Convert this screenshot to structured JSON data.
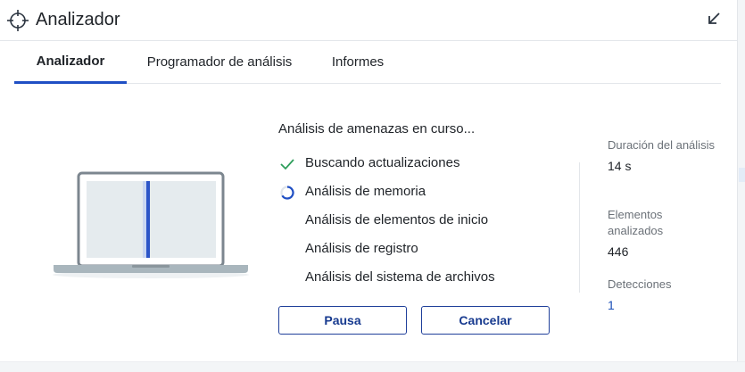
{
  "app": {
    "title": "Analizador",
    "icon": "crosshair-icon",
    "collapse_icon": "arrow-down-left-icon"
  },
  "tabs": [
    {
      "label": "Analizador",
      "active": true
    },
    {
      "label": "Programador de análisis",
      "active": false
    },
    {
      "label": "Informes",
      "active": false
    }
  ],
  "scan": {
    "status_title": "Análisis de amenazas en curso...",
    "steps": [
      {
        "label": "Buscando actualizaciones",
        "state": "done",
        "icon": "check-icon"
      },
      {
        "label": "Análisis de memoria",
        "state": "in-progress",
        "icon": "spinner-icon"
      },
      {
        "label": "Análisis de elementos de inicio",
        "state": "pending"
      },
      {
        "label": "Análisis de registro",
        "state": "pending"
      },
      {
        "label": "Análisis del sistema de archivos",
        "state": "pending"
      }
    ],
    "progress_fraction": 0.5
  },
  "buttons": {
    "pause_label": "Pausa",
    "cancel_label": "Cancelar"
  },
  "stats": {
    "duration_label": "Duración del análisis",
    "duration_value": "14 s",
    "items_label": "Elementos analizados",
    "items_value": "446",
    "detections_label": "Detecciones",
    "detections_value": "1"
  },
  "colors": {
    "accent": "#1f4fc4",
    "check": "#2e9e5b",
    "link": "#1a4fb8",
    "button_text": "#173a8f"
  }
}
